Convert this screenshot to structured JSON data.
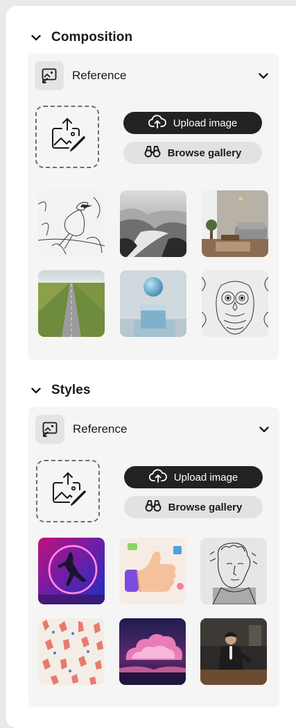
{
  "composition": {
    "title": "Composition",
    "reference_label": "Reference",
    "upload_label": "Upload image",
    "browse_label": "Browse gallery",
    "thumbnails": [
      "bird-sketch",
      "misty-lake",
      "living-room",
      "country-road",
      "sphere-on-cube",
      "owl-mandala"
    ]
  },
  "styles": {
    "title": "Styles",
    "reference_label": "Reference",
    "upload_label": "Upload image",
    "browse_label": "Browse gallery",
    "thumbnails": [
      "neon-dancer",
      "thumbs-up-3d",
      "classical-engraving",
      "hands-pattern",
      "pink-clouds",
      "man-in-suit"
    ]
  },
  "colors": {
    "accent_dark": "#222222",
    "card_bg": "#f5f5f5",
    "button_light": "#e2e2e2"
  },
  "icons": [
    "chevron-down-icon",
    "reference-image-icon",
    "image-upload-icon",
    "cloud-upload-icon",
    "binoculars-icon"
  ]
}
